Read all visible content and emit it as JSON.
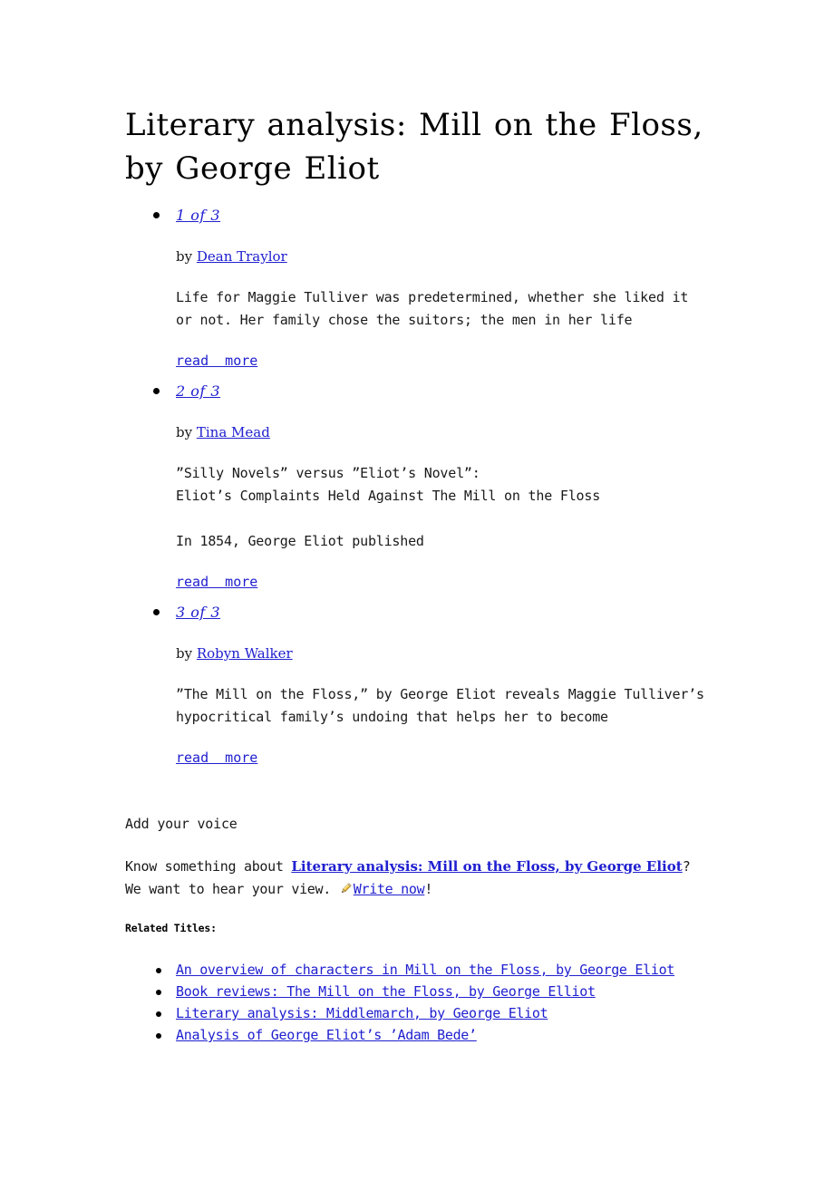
{
  "page": {
    "title": "Literary analysis: Mill on the Floss, by George Eliot"
  },
  "articles": [
    {
      "pager": "1 of 3",
      "by_prefix": "by ",
      "author": "Dean Traylor",
      "excerpt": "Life for Maggie Tulliver was predetermined, whether she liked it\nor not. Her family chose the suitors; the men in her life",
      "read_more": "read  more"
    },
    {
      "pager": "2 of 3",
      "by_prefix": "by ",
      "author": "Tina Mead",
      "excerpt": "”Silly Novels” versus ”Eliot’s Novel”:\nEliot’s Complaints Held Against The Mill on the Floss\n\nIn 1854, George Eliot published",
      "read_more": "read  more"
    },
    {
      "pager": "3 of 3",
      "by_prefix": "by ",
      "author": "Robyn Walker",
      "excerpt": "”The Mill on the Floss,” by George Eliot reveals Maggie Tulliver’s\nhypocritical family’s undoing that helps her to become",
      "read_more": "read  more"
    }
  ],
  "add_voice": {
    "heading": "Add your voice",
    "cta_prefix": "Know something about ",
    "cta_topic_link": "Literary analysis: Mill on the Floss, by George Eliot",
    "cta_middle": "?",
    "cta_second_line": "We want to hear your view. ",
    "write_link": "Write now",
    "cta_suffix": "!",
    "pencil_icon": "pencil-icon"
  },
  "related": {
    "label": "Related Titles:",
    "items": [
      "An overview of characters in Mill on the Floss, by George Eliot",
      "Book reviews: The Mill on the Floss, by George Elliot",
      "Literary analysis: Middlemarch, by George Eliot",
      "Analysis of George Eliot’s ’Adam Bede’"
    ]
  },
  "colors": {
    "link": "#2020d0",
    "text": "#1a1a1a",
    "background": "#ffffff"
  }
}
